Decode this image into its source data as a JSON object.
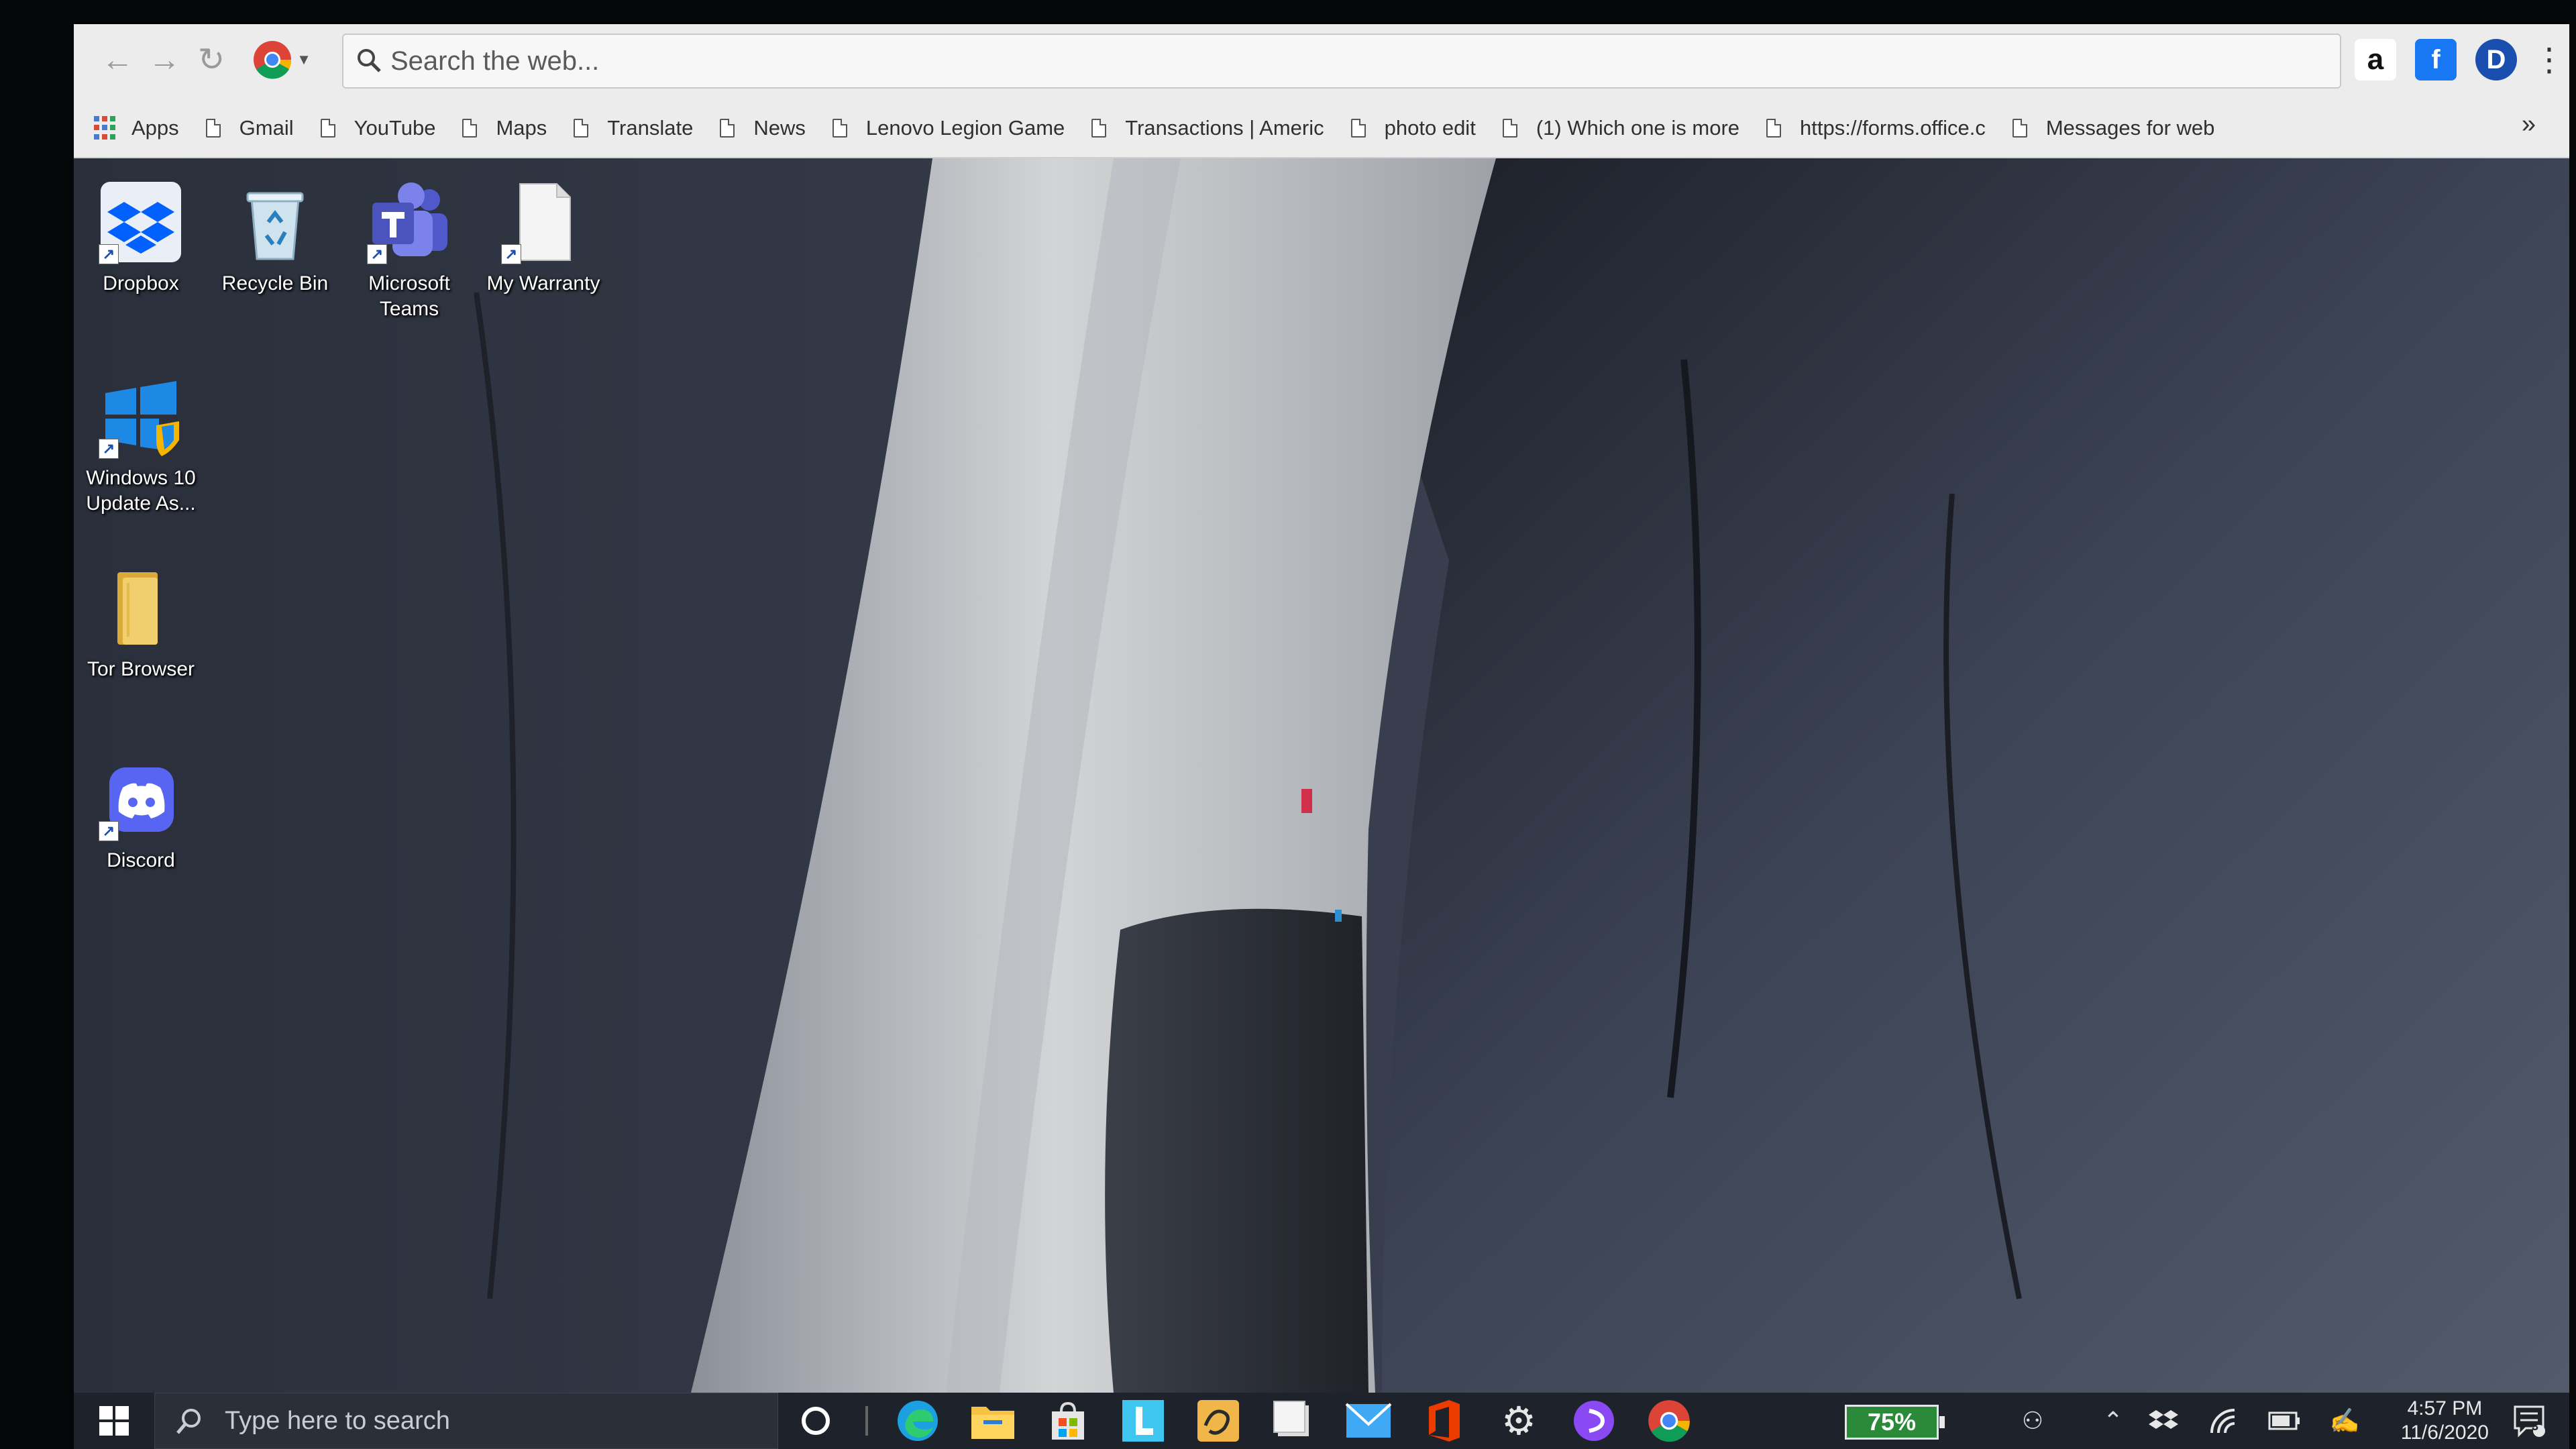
{
  "browser": {
    "omnibox_placeholder": "Search the web...",
    "bookmarks": [
      {
        "label": "Apps"
      },
      {
        "label": "Gmail"
      },
      {
        "label": "YouTube"
      },
      {
        "label": "Maps"
      },
      {
        "label": "Translate"
      },
      {
        "label": "News"
      },
      {
        "label": "Lenovo Legion Game"
      },
      {
        "label": "Transactions | Americ"
      },
      {
        "label": "photo edit"
      },
      {
        "label": "(1) Which one is more"
      },
      {
        "label": "https://forms.office.c"
      },
      {
        "label": "Messages for web"
      }
    ],
    "more_label": "»",
    "extensions": [
      {
        "icon": "amazon-icon",
        "glyph": "a"
      },
      {
        "icon": "facebook-icon",
        "glyph": "f"
      },
      {
        "icon": "profile-icon",
        "glyph": "D"
      }
    ]
  },
  "desktop": {
    "icons": [
      {
        "label": "Dropbox",
        "icon": "dropbox-icon"
      },
      {
        "label": "Recycle Bin",
        "icon": "recycle-bin-icon"
      },
      {
        "label": "Microsoft Teams",
        "icon": "teams-icon"
      },
      {
        "label": "My Warranty",
        "icon": "document-icon"
      },
      {
        "label": "Windows 10 Update As...",
        "icon": "windows-icon"
      },
      {
        "label": "Tor Browser",
        "icon": "folder-icon"
      },
      {
        "label": "Discord",
        "icon": "discord-icon"
      }
    ]
  },
  "taskbar": {
    "search_placeholder": "Type here to search",
    "battery_percent": "75%",
    "time": "4:57 PM",
    "date": "11/6/2020",
    "notification_count": "3",
    "colors": {
      "taskbar_bg": "#1e222a",
      "accent_blue": "#1e88e5",
      "battery_green": "#2a8a3a"
    }
  }
}
